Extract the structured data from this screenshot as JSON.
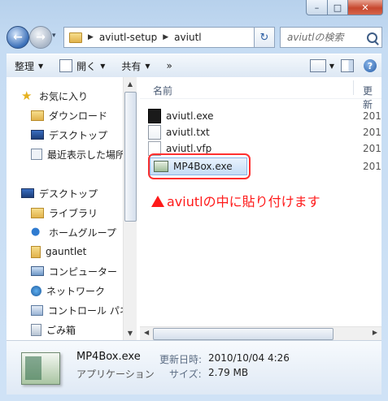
{
  "window": {
    "minimize": "–",
    "maximize": "□",
    "close": "✕"
  },
  "nav": {
    "back": "←",
    "forward": "→",
    "recent": "▾",
    "breadcrumb": [
      "aviutl-setup",
      "aviutl"
    ],
    "sep": "▶",
    "dropdown": "▼",
    "refresh": "↻",
    "search_placeholder": "aviutlの検索"
  },
  "toolbar": {
    "organize": "整理",
    "open": "開く",
    "share": "共有",
    "more": "»",
    "help": "?"
  },
  "sidebar": {
    "favorites": [
      "お気に入り",
      "ダウンロード",
      "デスクトップ",
      "最近表示した場所"
    ],
    "tree": [
      "デスクトップ",
      "ライブラリ",
      "ホームグループ",
      "gauntlet",
      "コンピューター",
      "ネットワーク",
      "コントロール パネル",
      "ごみ箱"
    ]
  },
  "columns": {
    "name": "名前",
    "modified": "更新"
  },
  "files": [
    {
      "name": "aviutl.exe",
      "date": "201"
    },
    {
      "name": "aviutl.txt",
      "date": "201"
    },
    {
      "name": "aviutl.vfp",
      "date": "201"
    },
    {
      "name": "MP4Box.exe",
      "date": "201"
    }
  ],
  "annotation": "aviutlの中に貼り付けます",
  "details": {
    "name": "MP4Box.exe",
    "type": "アプリケーション",
    "modified_label": "更新日時:",
    "modified_value": "2010/10/04 4:26",
    "size_label": "サイズ:",
    "size_value": "2.79 MB"
  },
  "colors": {
    "annotation": "#ff1a1a",
    "selection": "#c4dcf6",
    "frame": "#c6dcf3"
  }
}
